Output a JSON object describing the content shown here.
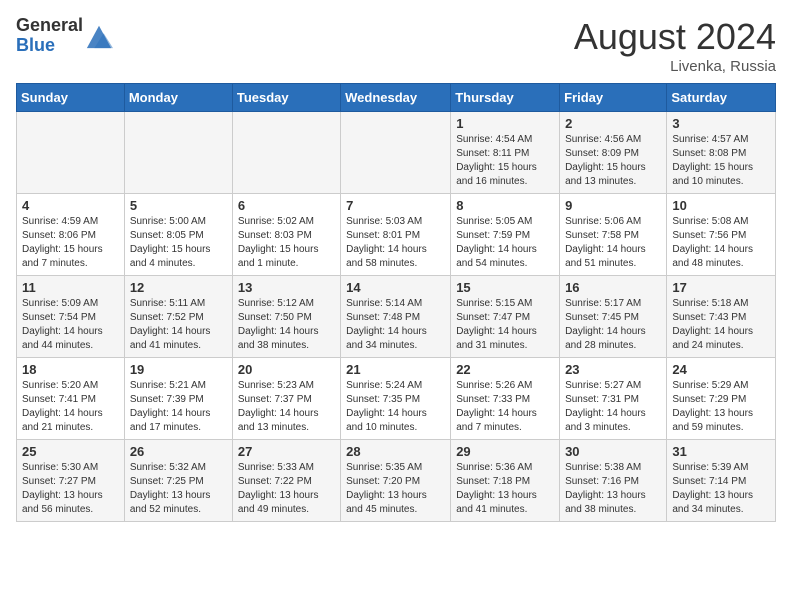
{
  "logo": {
    "general": "General",
    "blue": "Blue"
  },
  "title": {
    "month_year": "August 2024",
    "location": "Livenka, Russia"
  },
  "days_of_week": [
    "Sunday",
    "Monday",
    "Tuesday",
    "Wednesday",
    "Thursday",
    "Friday",
    "Saturday"
  ],
  "weeks": [
    [
      {
        "day": "",
        "sunrise": "",
        "sunset": "",
        "daylight": ""
      },
      {
        "day": "",
        "sunrise": "",
        "sunset": "",
        "daylight": ""
      },
      {
        "day": "",
        "sunrise": "",
        "sunset": "",
        "daylight": ""
      },
      {
        "day": "",
        "sunrise": "",
        "sunset": "",
        "daylight": ""
      },
      {
        "day": "1",
        "sunrise": "Sunrise: 4:54 AM",
        "sunset": "Sunset: 8:11 PM",
        "daylight": "Daylight: 15 hours and 16 minutes."
      },
      {
        "day": "2",
        "sunrise": "Sunrise: 4:56 AM",
        "sunset": "Sunset: 8:09 PM",
        "daylight": "Daylight: 15 hours and 13 minutes."
      },
      {
        "day": "3",
        "sunrise": "Sunrise: 4:57 AM",
        "sunset": "Sunset: 8:08 PM",
        "daylight": "Daylight: 15 hours and 10 minutes."
      }
    ],
    [
      {
        "day": "4",
        "sunrise": "Sunrise: 4:59 AM",
        "sunset": "Sunset: 8:06 PM",
        "daylight": "Daylight: 15 hours and 7 minutes."
      },
      {
        "day": "5",
        "sunrise": "Sunrise: 5:00 AM",
        "sunset": "Sunset: 8:05 PM",
        "daylight": "Daylight: 15 hours and 4 minutes."
      },
      {
        "day": "6",
        "sunrise": "Sunrise: 5:02 AM",
        "sunset": "Sunset: 8:03 PM",
        "daylight": "Daylight: 15 hours and 1 minute."
      },
      {
        "day": "7",
        "sunrise": "Sunrise: 5:03 AM",
        "sunset": "Sunset: 8:01 PM",
        "daylight": "Daylight: 14 hours and 58 minutes."
      },
      {
        "day": "8",
        "sunrise": "Sunrise: 5:05 AM",
        "sunset": "Sunset: 7:59 PM",
        "daylight": "Daylight: 14 hours and 54 minutes."
      },
      {
        "day": "9",
        "sunrise": "Sunrise: 5:06 AM",
        "sunset": "Sunset: 7:58 PM",
        "daylight": "Daylight: 14 hours and 51 minutes."
      },
      {
        "day": "10",
        "sunrise": "Sunrise: 5:08 AM",
        "sunset": "Sunset: 7:56 PM",
        "daylight": "Daylight: 14 hours and 48 minutes."
      }
    ],
    [
      {
        "day": "11",
        "sunrise": "Sunrise: 5:09 AM",
        "sunset": "Sunset: 7:54 PM",
        "daylight": "Daylight: 14 hours and 44 minutes."
      },
      {
        "day": "12",
        "sunrise": "Sunrise: 5:11 AM",
        "sunset": "Sunset: 7:52 PM",
        "daylight": "Daylight: 14 hours and 41 minutes."
      },
      {
        "day": "13",
        "sunrise": "Sunrise: 5:12 AM",
        "sunset": "Sunset: 7:50 PM",
        "daylight": "Daylight: 14 hours and 38 minutes."
      },
      {
        "day": "14",
        "sunrise": "Sunrise: 5:14 AM",
        "sunset": "Sunset: 7:48 PM",
        "daylight": "Daylight: 14 hours and 34 minutes."
      },
      {
        "day": "15",
        "sunrise": "Sunrise: 5:15 AM",
        "sunset": "Sunset: 7:47 PM",
        "daylight": "Daylight: 14 hours and 31 minutes."
      },
      {
        "day": "16",
        "sunrise": "Sunrise: 5:17 AM",
        "sunset": "Sunset: 7:45 PM",
        "daylight": "Daylight: 14 hours and 28 minutes."
      },
      {
        "day": "17",
        "sunrise": "Sunrise: 5:18 AM",
        "sunset": "Sunset: 7:43 PM",
        "daylight": "Daylight: 14 hours and 24 minutes."
      }
    ],
    [
      {
        "day": "18",
        "sunrise": "Sunrise: 5:20 AM",
        "sunset": "Sunset: 7:41 PM",
        "daylight": "Daylight: 14 hours and 21 minutes."
      },
      {
        "day": "19",
        "sunrise": "Sunrise: 5:21 AM",
        "sunset": "Sunset: 7:39 PM",
        "daylight": "Daylight: 14 hours and 17 minutes."
      },
      {
        "day": "20",
        "sunrise": "Sunrise: 5:23 AM",
        "sunset": "Sunset: 7:37 PM",
        "daylight": "Daylight: 14 hours and 13 minutes."
      },
      {
        "day": "21",
        "sunrise": "Sunrise: 5:24 AM",
        "sunset": "Sunset: 7:35 PM",
        "daylight": "Daylight: 14 hours and 10 minutes."
      },
      {
        "day": "22",
        "sunrise": "Sunrise: 5:26 AM",
        "sunset": "Sunset: 7:33 PM",
        "daylight": "Daylight: 14 hours and 7 minutes."
      },
      {
        "day": "23",
        "sunrise": "Sunrise: 5:27 AM",
        "sunset": "Sunset: 7:31 PM",
        "daylight": "Daylight: 14 hours and 3 minutes."
      },
      {
        "day": "24",
        "sunrise": "Sunrise: 5:29 AM",
        "sunset": "Sunset: 7:29 PM",
        "daylight": "Daylight: 13 hours and 59 minutes."
      }
    ],
    [
      {
        "day": "25",
        "sunrise": "Sunrise: 5:30 AM",
        "sunset": "Sunset: 7:27 PM",
        "daylight": "Daylight: 13 hours and 56 minutes."
      },
      {
        "day": "26",
        "sunrise": "Sunrise: 5:32 AM",
        "sunset": "Sunset: 7:25 PM",
        "daylight": "Daylight: 13 hours and 52 minutes."
      },
      {
        "day": "27",
        "sunrise": "Sunrise: 5:33 AM",
        "sunset": "Sunset: 7:22 PM",
        "daylight": "Daylight: 13 hours and 49 minutes."
      },
      {
        "day": "28",
        "sunrise": "Sunrise: 5:35 AM",
        "sunset": "Sunset: 7:20 PM",
        "daylight": "Daylight: 13 hours and 45 minutes."
      },
      {
        "day": "29",
        "sunrise": "Sunrise: 5:36 AM",
        "sunset": "Sunset: 7:18 PM",
        "daylight": "Daylight: 13 hours and 41 minutes."
      },
      {
        "day": "30",
        "sunrise": "Sunrise: 5:38 AM",
        "sunset": "Sunset: 7:16 PM",
        "daylight": "Daylight: 13 hours and 38 minutes."
      },
      {
        "day": "31",
        "sunrise": "Sunrise: 5:39 AM",
        "sunset": "Sunset: 7:14 PM",
        "daylight": "Daylight: 13 hours and 34 minutes."
      }
    ]
  ]
}
